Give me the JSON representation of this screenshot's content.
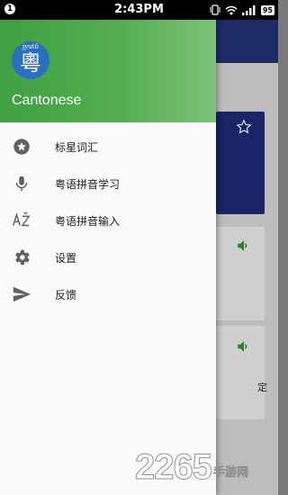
{
  "status_bar": {
    "notification_count": "1",
    "time": "2:43PM",
    "battery": "95"
  },
  "drawer": {
    "logo": {
      "pinyin": "jyut6",
      "character": "粵"
    },
    "app_name": "Cantonese",
    "header_color": "#4caf50",
    "items": [
      {
        "label": "标星词汇",
        "icon": "star-icon"
      },
      {
        "label": "粤语拼音学习",
        "icon": "microphone-icon"
      },
      {
        "label": "粤语拼音输入",
        "icon": "az-sort-icon"
      },
      {
        "label": "设置",
        "icon": "gear-icon"
      },
      {
        "label": "反馈",
        "icon": "send-icon"
      }
    ]
  },
  "background": {
    "toolbar_color": "#1e2a66",
    "partial_char": "定"
  },
  "watermark": {
    "number": "2265",
    "suffix": "手游网"
  }
}
